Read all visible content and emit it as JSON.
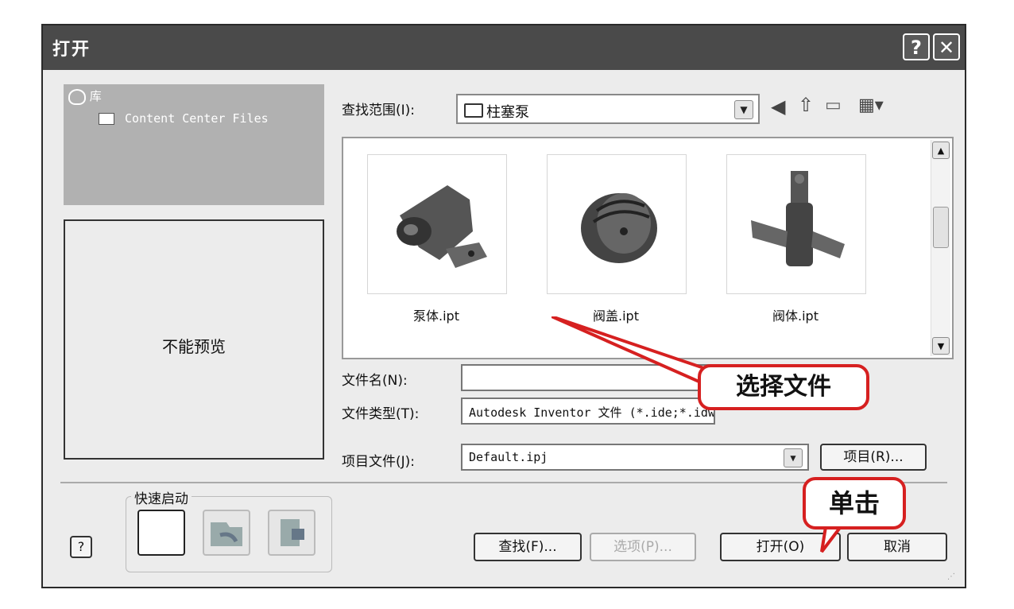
{
  "window": {
    "title": "打开",
    "help_glyph": "?",
    "close_glyph": "✕"
  },
  "library": {
    "root_label": "库",
    "item_label": "Content Center Files"
  },
  "preview": {
    "text": "不能预览"
  },
  "lookin": {
    "label": "查找范围(I):",
    "value": "柱塞泵"
  },
  "files": [
    {
      "name": "泵体.ipt"
    },
    {
      "name": "阀盖.ipt"
    },
    {
      "name": "阀体.ipt"
    }
  ],
  "form": {
    "filename_label": "文件名(N):",
    "filename_value": "",
    "filetype_label": "文件类型(T):",
    "filetype_value": "Autodesk Inventor 文件 (*.ide;*.idw;",
    "project_label": "项目文件(J):",
    "project_value": "Default.ipj",
    "project_button": "项目(R)..."
  },
  "quick_launch": {
    "title": "快速启动"
  },
  "buttons": {
    "help_glyph": "?",
    "find": "查找(F)...",
    "options": "选项(P)...",
    "open": "打开(O)",
    "cancel": "取消"
  },
  "annotations": {
    "select_file": "选择文件",
    "click": "单击"
  },
  "colors": {
    "callout_border": "#d62020",
    "titlebar": "#4a4a4a",
    "library_panel": "#b1b1b1"
  }
}
